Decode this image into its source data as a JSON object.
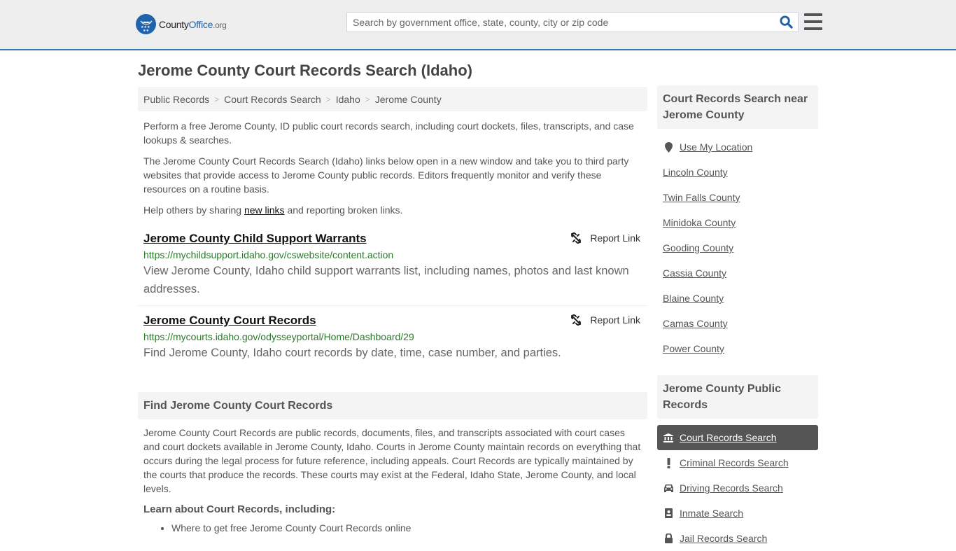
{
  "header": {
    "logo": {
      "county": "County",
      "office": "Office",
      "org": ".org"
    },
    "search": {
      "placeholder": "Search by government office, state, county, city or zip code",
      "value": ""
    },
    "colors": {
      "brand": "#1f63ad",
      "header_bg": "#eeeeee",
      "header_border": "#3a77ab"
    }
  },
  "page": {
    "title": "Jerome County Court Records Search (Idaho)"
  },
  "breadcrumb": [
    {
      "label": "Public Records"
    },
    {
      "label": "Court Records Search"
    },
    {
      "label": "Idaho"
    },
    {
      "label": "Jerome County"
    }
  ],
  "breadcrumb_sep": ">",
  "intro": {
    "p1": "Perform a free Jerome County, ID public court records search, including court dockets, files, transcripts, and case lookups & searches.",
    "p2": "The Jerome County Court Records Search (Idaho) links below open in a new window and take you to third party websites that provide access to Jerome County public records. Editors frequently monitor and verify these resources on a routine basis.",
    "p3_before": "Help others by sharing ",
    "p3_link": "new links",
    "p3_after": " and reporting broken links."
  },
  "results": [
    {
      "title": "Jerome County Child Support Warrants",
      "url": "https://mychildsupport.idaho.gov/cswebsite/content.action",
      "description": "View Jerome County, Idaho child support warrants list, including names, photos and last known addresses.",
      "report_label": "Report Link"
    },
    {
      "title": "Jerome County Court Records",
      "url": "https://mycourts.idaho.gov/odysseyportal/Home/Dashboard/29",
      "description": "Find Jerome County, Idaho court records by date, time, case number, and parties.",
      "report_label": "Report Link"
    }
  ],
  "find_section": {
    "heading": "Find Jerome County Court Records",
    "body": "Jerome County Court Records are public records, documents, files, and transcripts associated with court cases and court dockets available in Jerome County, Idaho. Courts in Jerome County maintain records on everything that occurs during the legal process for future reference, including appeals. Court Records are typically maintained by the courts that produce the records. These courts may exist at the Federal, Idaho State, Jerome County, and local levels.",
    "learn_heading": "Learn about Court Records, including:",
    "learn_items": [
      "Where to get free Jerome County Court Records online"
    ]
  },
  "sidebar": {
    "nearby_heading": "Court Records Search near Jerome County",
    "use_location": "Use My Location",
    "nearby": [
      "Lincoln County",
      "Twin Falls County",
      "Minidoka County",
      "Gooding County",
      "Cassia County",
      "Blaine County",
      "Camas County",
      "Power County"
    ],
    "records_heading": "Jerome County Public Records",
    "records": [
      {
        "label": "Court Records Search",
        "icon": "courthouse-icon",
        "active": true
      },
      {
        "label": "Criminal Records Search",
        "icon": "exclamation-icon",
        "active": false
      },
      {
        "label": "Driving Records Search",
        "icon": "car-icon",
        "active": false
      },
      {
        "label": "Inmate Search",
        "icon": "id-badge-icon",
        "active": false
      },
      {
        "label": "Jail Records Search",
        "icon": "lock-icon",
        "active": false
      }
    ]
  }
}
